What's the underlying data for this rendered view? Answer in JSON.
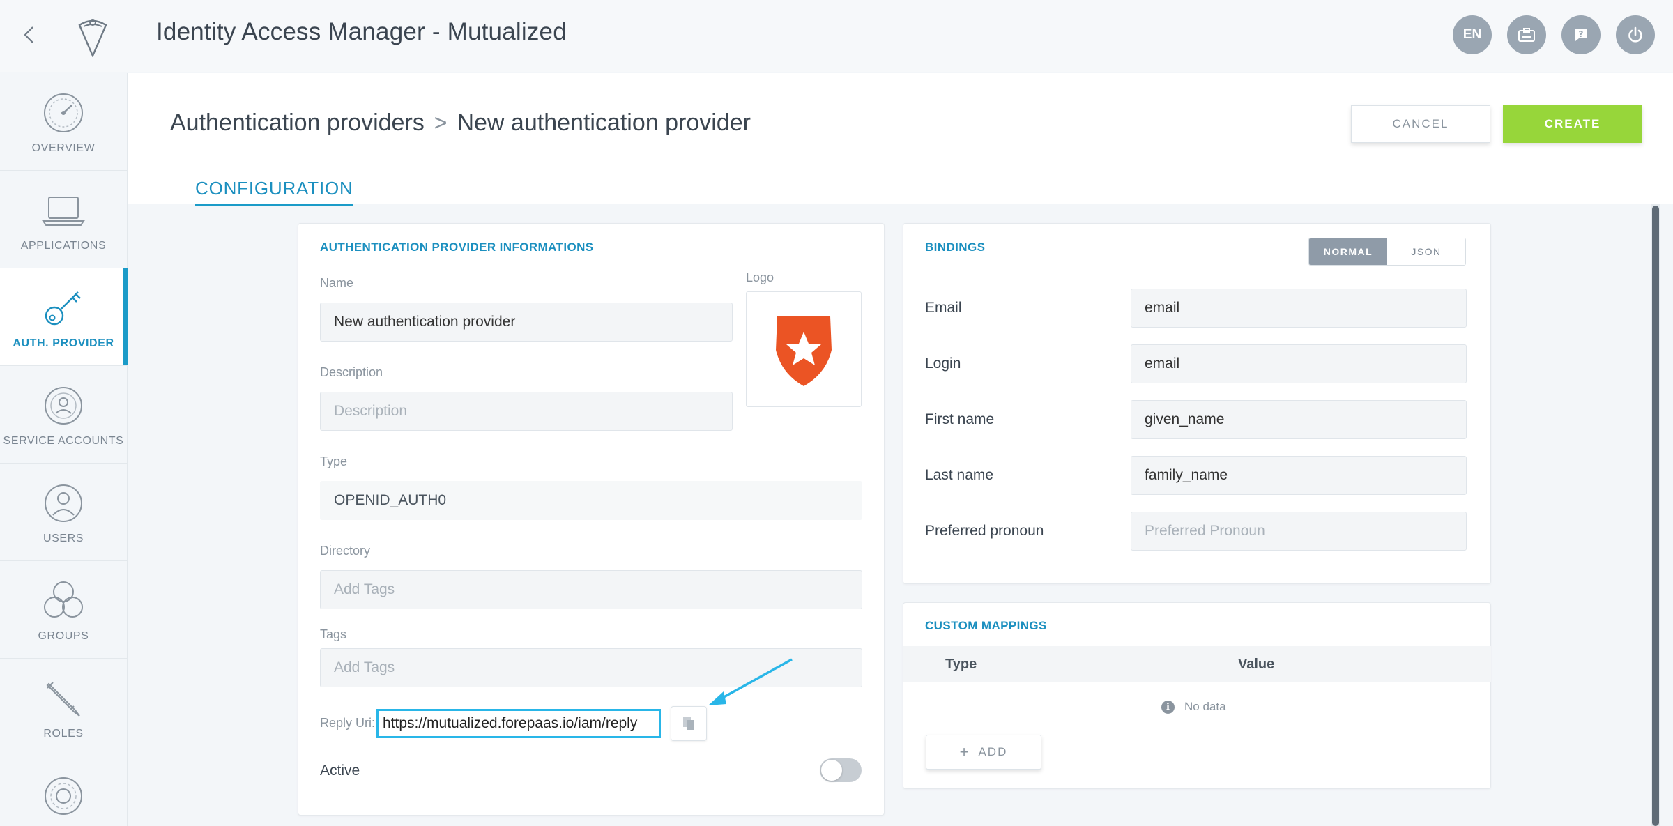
{
  "header": {
    "title": "Identity Access Manager - Mutualized",
    "lang": "EN"
  },
  "sidebar": {
    "items": [
      {
        "label": "OVERVIEW",
        "icon": "gauge-icon"
      },
      {
        "label": "APPLICATIONS",
        "icon": "laptop-icon"
      },
      {
        "label": "AUTH. PROVIDER",
        "icon": "key-icon"
      },
      {
        "label": "SERVICE ACCOUNTS",
        "icon": "service-accounts-icon"
      },
      {
        "label": "USERS",
        "icon": "user-icon"
      },
      {
        "label": "GROUPS",
        "icon": "group-icon"
      },
      {
        "label": "ROLES",
        "icon": "pencil-icon"
      }
    ]
  },
  "breadcrumb": {
    "parent": "Authentication providers",
    "current": "New authentication provider"
  },
  "actions": {
    "cancel": "CANCEL",
    "create": "CREATE"
  },
  "tabs": {
    "configuration": "CONFIGURATION"
  },
  "info_card": {
    "title": "AUTHENTICATION PROVIDER INFORMATIONS",
    "name_label": "Name",
    "name_value": "New authentication provider",
    "logo_label": "Logo",
    "description_label": "Description",
    "description_placeholder": "Description",
    "type_label": "Type",
    "type_value": "OPENID_AUTH0",
    "directory_label": "Directory",
    "directory_placeholder": "Add Tags",
    "tags_label": "Tags",
    "tags_placeholder": "Add Tags",
    "reply_label": "Reply Uri:",
    "reply_value": "https://mutualized.forepaas.io/iam/reply",
    "active_label": "Active",
    "active_on": false
  },
  "bindings": {
    "title": "BINDINGS",
    "mode_normal": "NORMAL",
    "mode_json": "JSON",
    "rows": [
      {
        "label": "Email",
        "value": "email",
        "placeholder": ""
      },
      {
        "label": "Login",
        "value": "email",
        "placeholder": ""
      },
      {
        "label": "First name",
        "value": "given_name",
        "placeholder": ""
      },
      {
        "label": "Last name",
        "value": "family_name",
        "placeholder": ""
      },
      {
        "label": "Preferred pronoun",
        "value": "",
        "placeholder": "Preferred Pronoun"
      }
    ]
  },
  "custom_mappings": {
    "title": "CUSTOM MAPPINGS",
    "col_type": "Type",
    "col_value": "Value",
    "empty_text": "No data",
    "add_label": "ADD"
  },
  "colors": {
    "accent": "#1b9bc8",
    "create": "#97d63a",
    "highlight": "#29b6e8",
    "auth0_logo": "#eb5424"
  }
}
